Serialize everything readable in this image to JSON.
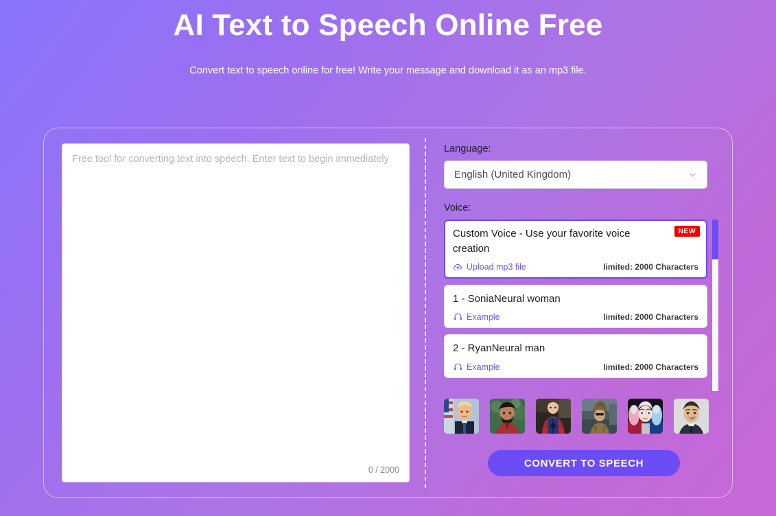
{
  "header": {
    "title": "AI Text to Speech Online Free",
    "subtitle": "Convert text to speech online for free! Write your message and download it as an mp3 file."
  },
  "editor": {
    "placeholder": "Free tool for converting text into speech. Enter text to begin immediately",
    "value": "",
    "counter": "0 / 2000"
  },
  "controls": {
    "language_label": "Language:",
    "language_value": "English (United Kingdom)",
    "voice_label": "Voice:",
    "convert_label": "CONVERT TO SPEECH"
  },
  "voices": [
    {
      "name": "Custom Voice - Use your favorite voice creation",
      "action": "Upload mp3 file",
      "action_icon": "cloud-upload-icon",
      "limit": "limited: 2000 Characters",
      "badge": "NEW",
      "selected": true
    },
    {
      "name": "1 - SoniaNeural woman",
      "action": "Example",
      "action_icon": "headphones-icon",
      "limit": "limited: 2000 Characters",
      "badge": "",
      "selected": false
    },
    {
      "name": "2 - RyanNeural man",
      "action": "Example",
      "action_icon": "headphones-icon",
      "limit": "limited: 2000 Characters",
      "badge": "",
      "selected": false
    }
  ],
  "avatars": [
    {
      "name": "avatar-politician-suit"
    },
    {
      "name": "avatar-bearded-man-red"
    },
    {
      "name": "avatar-spiderman"
    },
    {
      "name": "avatar-monkey-king"
    },
    {
      "name": "avatar-harley-quinn"
    },
    {
      "name": "avatar-man-grey-background"
    }
  ],
  "colors": {
    "accent": "#6b4cf5",
    "badge": "#f40000",
    "gradient_start": "#8a74fb",
    "gradient_end": "#c967d8"
  }
}
